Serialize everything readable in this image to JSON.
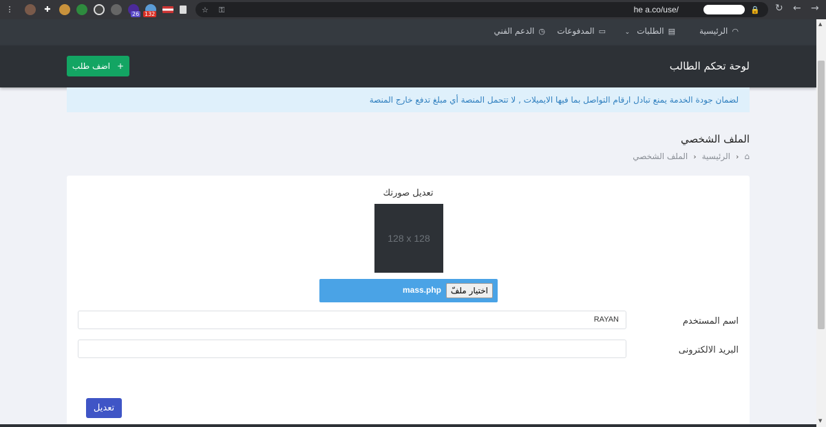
{
  "browser": {
    "address_text": "he   a.co/use/",
    "ext_badge_1": "26",
    "ext_badge_2": "132"
  },
  "nav": {
    "home": "الرئيسية",
    "orders": "الطلبات",
    "payments": "المدفوعات",
    "support": "الدعم الفني"
  },
  "header": {
    "title": "لوحة تحكم الطالب",
    "add_button": "اضف طلب"
  },
  "alert": {
    "text": "لضمان جودة الخدمة يمنع تبادل ارقام التواصل بما فيها الايميلات , لا تتحمل المنصة أي مبلغ تدفع خارج المنصة"
  },
  "page": {
    "title": "الملف الشخصي",
    "breadcrumb_home": "الرئيسية",
    "breadcrumb_current": "الملف الشخصي"
  },
  "profile": {
    "photo_label": "تعديل صورتك",
    "photo_placeholder": "128 x 128",
    "file_button": "اختيار ملفّ",
    "file_name": "mass.php",
    "username_label": "اسم المستخدم",
    "username_value": "RAYAN",
    "email_label": "البريد الالكترونى",
    "email_value": "",
    "submit_button": "تعديل"
  }
}
